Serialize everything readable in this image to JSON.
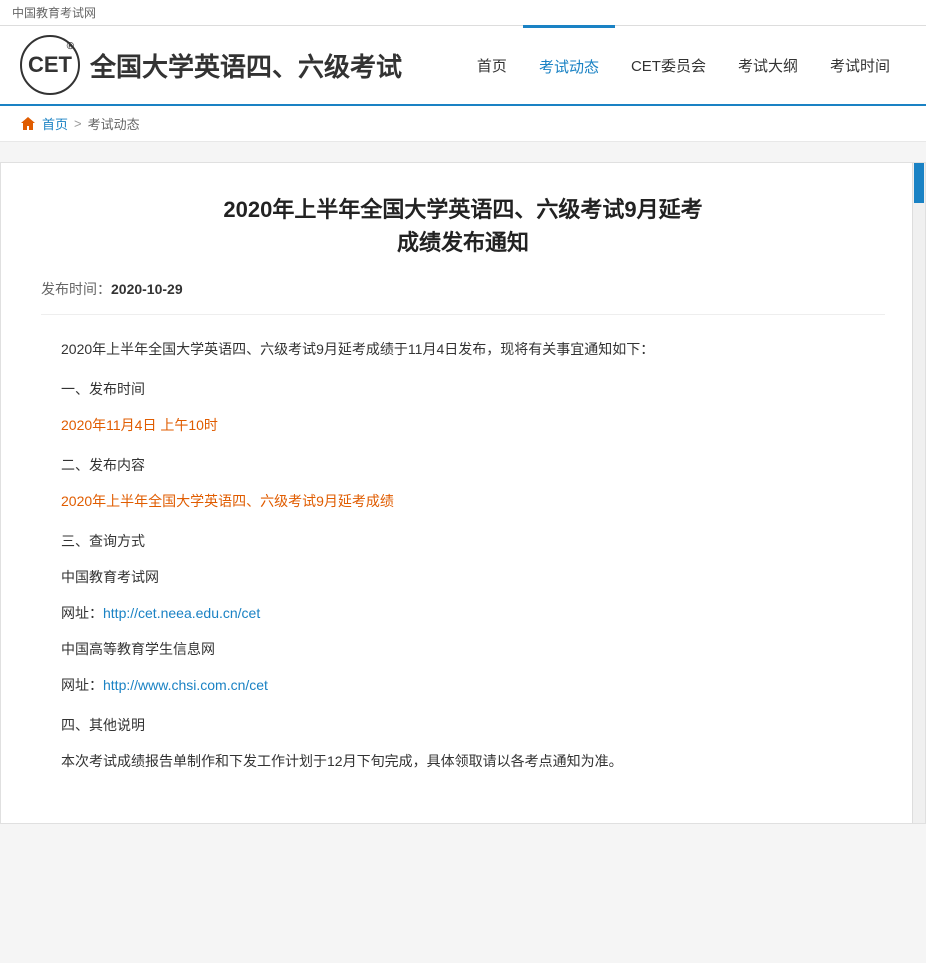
{
  "topbar": {
    "label": "中国教育考试网"
  },
  "header": {
    "logo_text": "CET",
    "registered_symbol": "®",
    "site_title": "全国大学英语四、六级考试",
    "nav": [
      {
        "label": "首页",
        "active": false
      },
      {
        "label": "考试动态",
        "active": true
      },
      {
        "label": "CET委员会",
        "active": false
      },
      {
        "label": "考试大纲",
        "active": false
      },
      {
        "label": "考试时间",
        "active": false
      }
    ]
  },
  "breadcrumb": {
    "home_label": "首页",
    "separator": ">",
    "current": "考试动态"
  },
  "article": {
    "title_line1": "2020年上半年全国大学英语四、六级考试9月延考",
    "title_line2": "成绩发布通知",
    "publish_label": "发布时间：",
    "publish_date": "2020-10-29",
    "intro": "2020年上半年全国大学英语四、六级考试9月延考成绩于11月4日发布，现将有关事宜通知如下：",
    "section1_header": "一、发布时间",
    "section1_content": "2020年11月4日 上午10时",
    "section2_header": "二、发布内容",
    "section2_content": "2020年上半年全国大学英语四、六级考试9月延考成绩",
    "section3_header": "三、查询方式",
    "org1_name": "中国教育考试网",
    "org1_url_label": "网址：",
    "org1_url": "http://cet.neea.edu.cn/cet",
    "org2_name": "中国高等教育学生信息网",
    "org2_url_label": "网址：",
    "org2_url": "http://www.chsi.com.cn/cet",
    "section4_header": "四、其他说明",
    "section4_content": "本次考试成绩报告单制作和下发工作计划于12月下旬完成，具体领取请以各考点通知为准。"
  },
  "colors": {
    "primary": "#1a82c4",
    "accent_orange": "#e05c00",
    "text_dark": "#333",
    "text_muted": "#666"
  }
}
